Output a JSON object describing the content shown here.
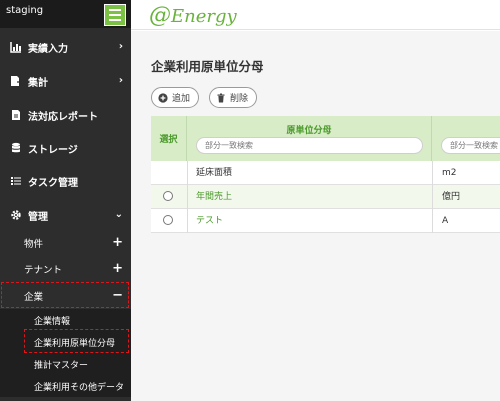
{
  "env_label": "staging",
  "logo": {
    "at": "@",
    "text": "Energy"
  },
  "sidebar": {
    "items": [
      {
        "label": "実績入力",
        "icon": "bar-chart-icon"
      },
      {
        "label": "集計",
        "icon": "file-export-icon"
      },
      {
        "label": "法対応レポート",
        "icon": "document-icon"
      },
      {
        "label": "ストレージ",
        "icon": "database-icon"
      },
      {
        "label": "タスク管理",
        "icon": "task-list-icon"
      },
      {
        "label": "管理",
        "icon": "gear-icon"
      }
    ],
    "sub_items": [
      {
        "label": "物件"
      },
      {
        "label": "テナント"
      },
      {
        "label": "企業"
      }
    ],
    "sub_sub_items": [
      {
        "label": "企業情報"
      },
      {
        "label": "企業利用原単位分母"
      },
      {
        "label": "推計マスター"
      },
      {
        "label": "企業利用その他データ"
      }
    ]
  },
  "page": {
    "title": "企業利用原単位分母",
    "add_label": "追加",
    "delete_label": "削除"
  },
  "table": {
    "select_header": "選択",
    "name_header": "原単位分母",
    "search_placeholder": "部分一致検索",
    "rows": [
      {
        "name": "延床面積",
        "unit": "m2",
        "has_radio": false,
        "link": false
      },
      {
        "name": "年間売上",
        "unit": "億円",
        "has_radio": true,
        "link": true
      },
      {
        "name": "テスト",
        "unit": "A",
        "has_radio": true,
        "link": true
      }
    ]
  },
  "colors": {
    "accent": "#7bc143",
    "sidebar": "#2d2d2d",
    "header_green": "#d8ecc8",
    "link_green": "#4a9a2a",
    "highlight_dash": "#e0151a"
  }
}
